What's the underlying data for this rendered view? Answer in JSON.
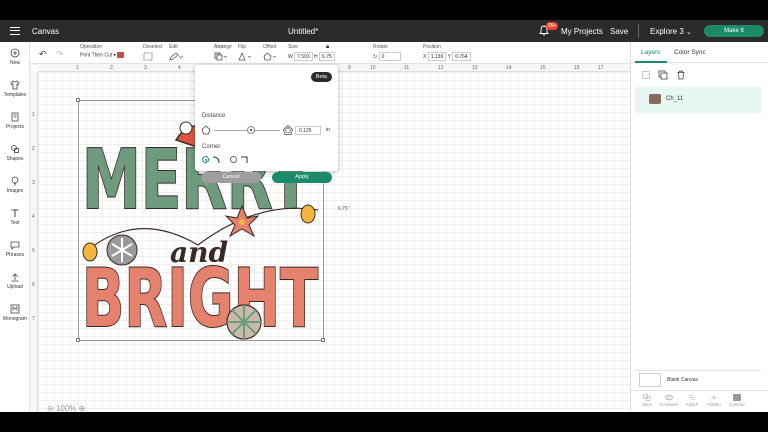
{
  "topbar": {
    "app_section": "Canvas",
    "project_title": "Untitled*",
    "notif_count": "99+",
    "my_projects": "My Projects",
    "save": "Save",
    "machine": "Explore 3",
    "make_it": "Make It"
  },
  "toolbar": {
    "operation_label": "Operation",
    "operation_value": "Print Then Cut",
    "deselect_label": "Deselect",
    "edit_label": "Edit",
    "align_label": "Align",
    "arrange_label": "Arrange",
    "flip_label": "Flip",
    "offset_label": "Offset",
    "size_label": "Size",
    "size_w_label": "W",
    "size_w": "7.503",
    "size_h_label": "H",
    "size_h": "6.75",
    "rotate_label": "Rotate",
    "rotate_value": "0",
    "position_label": "Position",
    "pos_x_label": "X",
    "pos_x": "1.139",
    "pos_y_label": "Y",
    "pos_y": "0.764"
  },
  "sidebar": {
    "items": [
      {
        "label": "New"
      },
      {
        "label": "Templates"
      },
      {
        "label": "Projects"
      },
      {
        "label": "Shapes"
      },
      {
        "label": "Images"
      },
      {
        "label": "Text"
      },
      {
        "label": "Phrases"
      },
      {
        "label": "Upload"
      },
      {
        "label": "Monogram"
      }
    ]
  },
  "rulers": {
    "top": [
      "1",
      "2",
      "3",
      "4",
      "5",
      "6",
      "7",
      "8",
      "9",
      "10",
      "11",
      "12",
      "13",
      "14",
      "15",
      "16",
      "17"
    ],
    "left": [
      "1",
      "2",
      "3",
      "4",
      "5",
      "6",
      "7"
    ]
  },
  "design": {
    "word1": "MERRY",
    "word2": "and",
    "word3": "BRIGHT",
    "height_label": "6.75\""
  },
  "offset_popup": {
    "badge": "Beta",
    "distance_label": "Distance",
    "distance_value": "0.125",
    "distance_unit": "in",
    "corner_label": "Corner",
    "cancel": "Cancel",
    "apply": "Apply"
  },
  "zoom": {
    "value": "100%"
  },
  "right_panel": {
    "tabs": [
      "Layers",
      "Color Sync"
    ],
    "active_tab": "Layers",
    "layers": [
      {
        "name": "Ch_11"
      }
    ],
    "blank_canvas": "Blank Canvas",
    "bottom_tools": [
      "Slice",
      "Combine",
      "Attach",
      "Flatten",
      "Contour"
    ]
  },
  "colors": {
    "accent": "#1a8a68",
    "topbar": "#2b2b2b",
    "merry_green": "#6e9a7e",
    "bright_coral": "#e4826d",
    "bright_red": "#d9553f"
  }
}
